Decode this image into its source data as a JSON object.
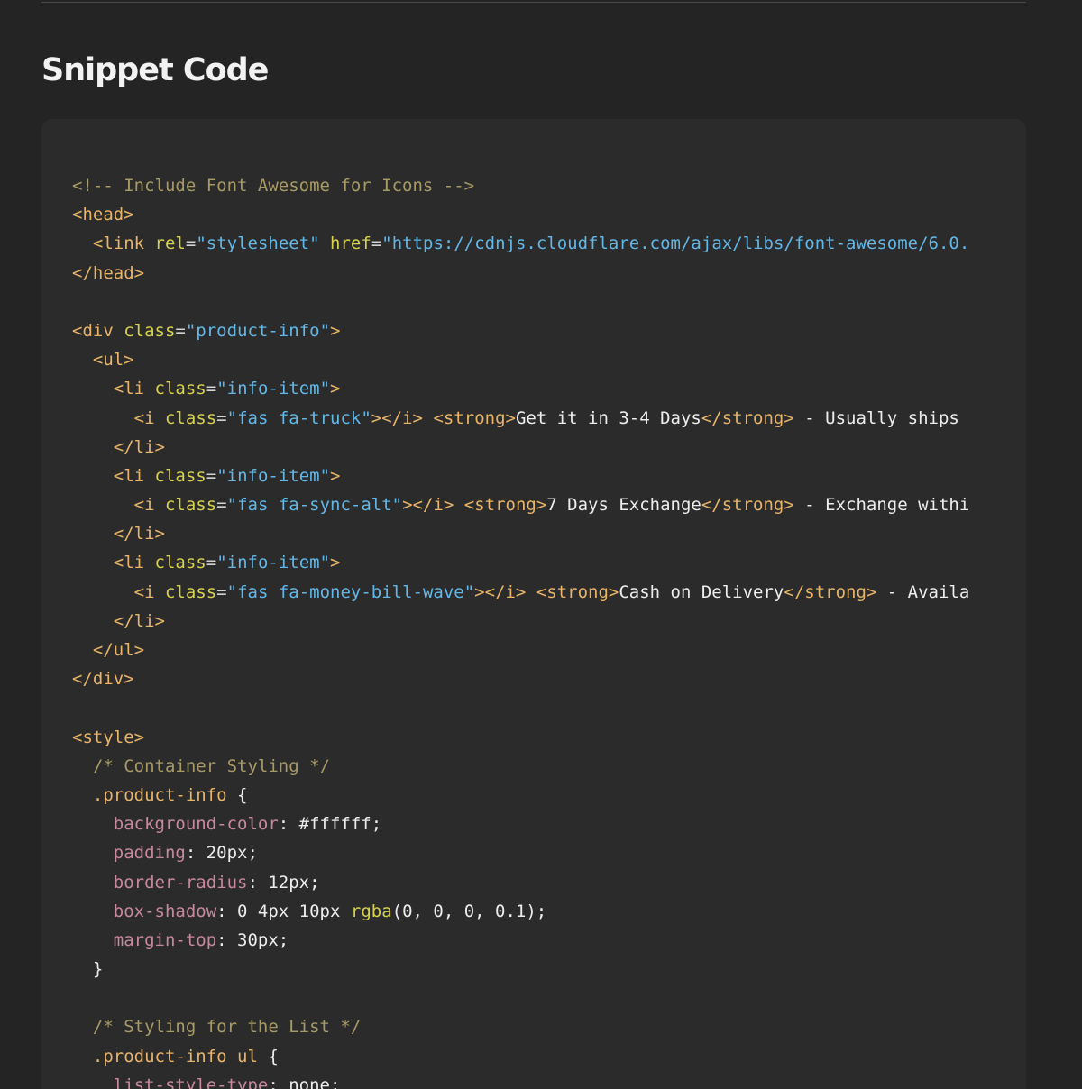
{
  "heading": "Snippet Code",
  "code_lines": [
    [
      {
        "k": "c",
        "t": "<!-- Include Font Awesome for Icons -->"
      }
    ],
    [
      {
        "k": "t",
        "t": "<head>"
      }
    ],
    [
      {
        "k": "p",
        "t": "  "
      },
      {
        "k": "t",
        "t": "<link "
      },
      {
        "k": "a",
        "t": "rel"
      },
      {
        "k": "p",
        "t": "="
      },
      {
        "k": "s",
        "t": "\"stylesheet\""
      },
      {
        "k": "p",
        "t": " "
      },
      {
        "k": "a",
        "t": "href"
      },
      {
        "k": "p",
        "t": "="
      },
      {
        "k": "s",
        "t": "\"https://cdnjs.cloudflare.com/ajax/libs/font-awesome/6.0."
      }
    ],
    [
      {
        "k": "t",
        "t": "</head>"
      }
    ],
    [],
    [
      {
        "k": "t",
        "t": "<div "
      },
      {
        "k": "a",
        "t": "class"
      },
      {
        "k": "p",
        "t": "="
      },
      {
        "k": "s",
        "t": "\"product-info\""
      },
      {
        "k": "t",
        "t": ">"
      }
    ],
    [
      {
        "k": "p",
        "t": "  "
      },
      {
        "k": "t",
        "t": "<ul>"
      }
    ],
    [
      {
        "k": "p",
        "t": "    "
      },
      {
        "k": "t",
        "t": "<li "
      },
      {
        "k": "a",
        "t": "class"
      },
      {
        "k": "p",
        "t": "="
      },
      {
        "k": "s",
        "t": "\"info-item\""
      },
      {
        "k": "t",
        "t": ">"
      }
    ],
    [
      {
        "k": "p",
        "t": "      "
      },
      {
        "k": "t",
        "t": "<i "
      },
      {
        "k": "a",
        "t": "class"
      },
      {
        "k": "p",
        "t": "="
      },
      {
        "k": "s",
        "t": "\"fas fa-truck\""
      },
      {
        "k": "t",
        "t": "></i>"
      },
      {
        "k": "p",
        "t": " "
      },
      {
        "k": "t",
        "t": "<strong>"
      },
      {
        "k": "x",
        "t": "Get it in 3-4 Days"
      },
      {
        "k": "t",
        "t": "</strong>"
      },
      {
        "k": "x",
        "t": " - Usually ships"
      }
    ],
    [
      {
        "k": "p",
        "t": "    "
      },
      {
        "k": "t",
        "t": "</li>"
      }
    ],
    [
      {
        "k": "p",
        "t": "    "
      },
      {
        "k": "t",
        "t": "<li "
      },
      {
        "k": "a",
        "t": "class"
      },
      {
        "k": "p",
        "t": "="
      },
      {
        "k": "s",
        "t": "\"info-item\""
      },
      {
        "k": "t",
        "t": ">"
      }
    ],
    [
      {
        "k": "p",
        "t": "      "
      },
      {
        "k": "t",
        "t": "<i "
      },
      {
        "k": "a",
        "t": "class"
      },
      {
        "k": "p",
        "t": "="
      },
      {
        "k": "s",
        "t": "\"fas fa-sync-alt\""
      },
      {
        "k": "t",
        "t": "></i>"
      },
      {
        "k": "p",
        "t": " "
      },
      {
        "k": "t",
        "t": "<strong>"
      },
      {
        "k": "x",
        "t": "7 Days Exchange"
      },
      {
        "k": "t",
        "t": "</strong>"
      },
      {
        "k": "x",
        "t": " - Exchange withi"
      }
    ],
    [
      {
        "k": "p",
        "t": "    "
      },
      {
        "k": "t",
        "t": "</li>"
      }
    ],
    [
      {
        "k": "p",
        "t": "    "
      },
      {
        "k": "t",
        "t": "<li "
      },
      {
        "k": "a",
        "t": "class"
      },
      {
        "k": "p",
        "t": "="
      },
      {
        "k": "s",
        "t": "\"info-item\""
      },
      {
        "k": "t",
        "t": ">"
      }
    ],
    [
      {
        "k": "p",
        "t": "      "
      },
      {
        "k": "t",
        "t": "<i "
      },
      {
        "k": "a",
        "t": "class"
      },
      {
        "k": "p",
        "t": "="
      },
      {
        "k": "s",
        "t": "\"fas fa-money-bill-wave\""
      },
      {
        "k": "t",
        "t": "></i>"
      },
      {
        "k": "p",
        "t": " "
      },
      {
        "k": "t",
        "t": "<strong>"
      },
      {
        "k": "x",
        "t": "Cash on Delivery"
      },
      {
        "k": "t",
        "t": "</strong>"
      },
      {
        "k": "x",
        "t": " - Availa"
      }
    ],
    [
      {
        "k": "p",
        "t": "    "
      },
      {
        "k": "t",
        "t": "</li>"
      }
    ],
    [
      {
        "k": "p",
        "t": "  "
      },
      {
        "k": "t",
        "t": "</ul>"
      }
    ],
    [
      {
        "k": "t",
        "t": "</div>"
      }
    ],
    [],
    [
      {
        "k": "t",
        "t": "<style>"
      }
    ],
    [
      {
        "k": "p",
        "t": "  "
      },
      {
        "k": "c",
        "t": "/* Container Styling */"
      }
    ],
    [
      {
        "k": "p",
        "t": "  "
      },
      {
        "k": "sel",
        "t": ".product-info"
      },
      {
        "k": "v",
        "t": " {"
      }
    ],
    [
      {
        "k": "p",
        "t": "    "
      },
      {
        "k": "pr",
        "t": "background-color"
      },
      {
        "k": "v",
        "t": ": #ffffff;"
      }
    ],
    [
      {
        "k": "p",
        "t": "    "
      },
      {
        "k": "pr",
        "t": "padding"
      },
      {
        "k": "v",
        "t": ": 20px;"
      }
    ],
    [
      {
        "k": "p",
        "t": "    "
      },
      {
        "k": "pr",
        "t": "border-radius"
      },
      {
        "k": "v",
        "t": ": 12px;"
      }
    ],
    [
      {
        "k": "p",
        "t": "    "
      },
      {
        "k": "pr",
        "t": "box-shadow"
      },
      {
        "k": "v",
        "t": ": 0 4px 10px "
      },
      {
        "k": "fn",
        "t": "rgba"
      },
      {
        "k": "v",
        "t": "(0, 0, 0, 0.1);"
      }
    ],
    [
      {
        "k": "p",
        "t": "    "
      },
      {
        "k": "pr",
        "t": "margin-top"
      },
      {
        "k": "v",
        "t": ": 30px;"
      }
    ],
    [
      {
        "k": "p",
        "t": "  "
      },
      {
        "k": "v",
        "t": "}"
      }
    ],
    [],
    [
      {
        "k": "p",
        "t": "  "
      },
      {
        "k": "c",
        "t": "/* Styling for the List */"
      }
    ],
    [
      {
        "k": "p",
        "t": "  "
      },
      {
        "k": "sel",
        "t": ".product-info ul"
      },
      {
        "k": "v",
        "t": " {"
      }
    ],
    [
      {
        "k": "p",
        "t": "    "
      },
      {
        "k": "pr",
        "t": "list-style-type"
      },
      {
        "k": "v",
        "t": ": none;"
      }
    ]
  ]
}
